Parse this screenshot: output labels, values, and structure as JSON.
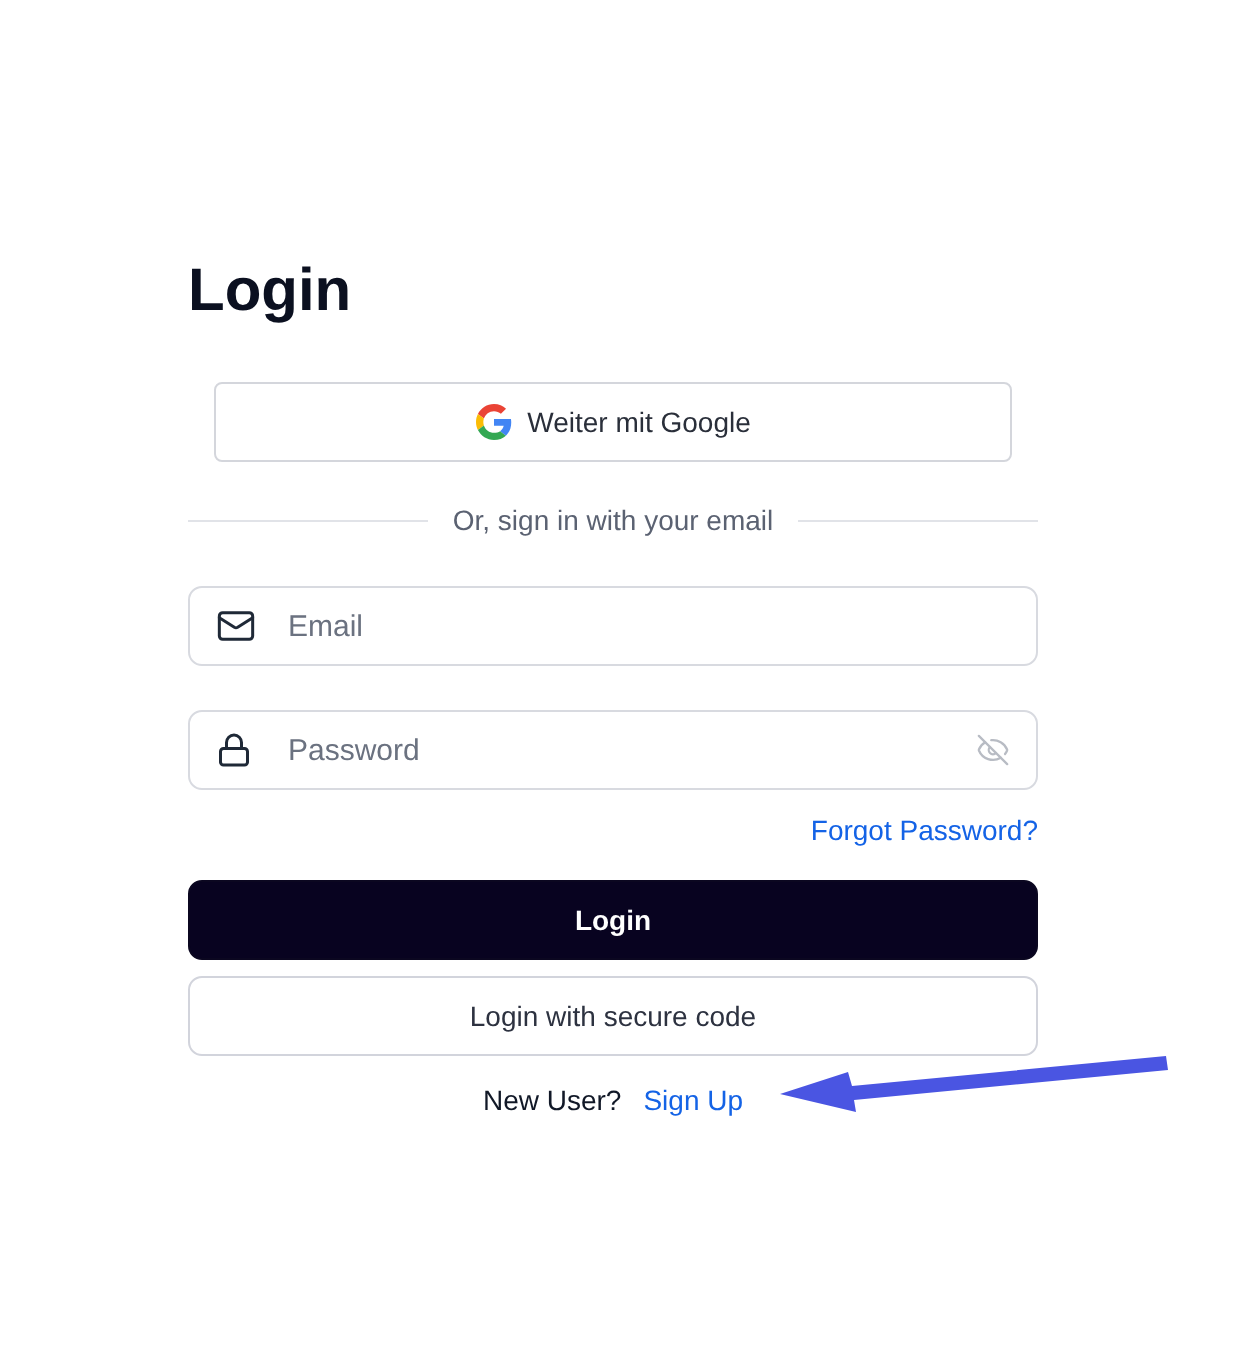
{
  "title": "Login",
  "google_button": {
    "label": "Weiter mit Google"
  },
  "divider": {
    "label": "Or, sign in with your email"
  },
  "fields": [
    {
      "kind": "email",
      "placeholder": "Email"
    },
    {
      "kind": "password",
      "placeholder": "Password"
    }
  ],
  "forgot_link": "Forgot Password?",
  "buttons": [
    {
      "kind": "primary",
      "label": "Login"
    },
    {
      "kind": "secondary",
      "label": "Login with secure code"
    }
  ],
  "signup": {
    "prompt": "New User?",
    "link": "Sign Up"
  }
}
